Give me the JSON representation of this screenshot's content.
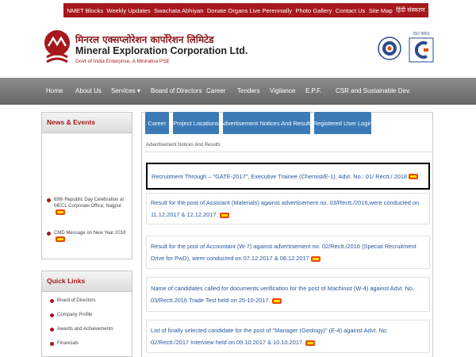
{
  "top_links": [
    "NMET Blocks",
    "Weekly Updates",
    "Swachata Abhiyan",
    "Donate Organs Live Perennially",
    "Photo Gallery",
    "Contact Us",
    "Site Map",
    "हिंदी संस्करण"
  ],
  "header": {
    "hindi_name": "मिनरल एक्सप्लोरेशन कार्पोरेशन लिमिटेड",
    "company_name": "Mineral Exploration Corporation Ltd.",
    "govt_line": "Govt of India Enterprise, A Miniratna PSE",
    "cert_label": "ISO 9001"
  },
  "nav": [
    "Home",
    "About Us",
    "Services ▾",
    "Board of Directors",
    "Career",
    "Tenders",
    "Vigilance",
    "E.P.F.",
    "CSR and Sustainable Dev."
  ],
  "news": {
    "title": "News & Events",
    "items": [
      "69th Republic Day Celebration at MECL Corporate Office, Nagpur",
      "CMD Message on New Year 2018"
    ]
  },
  "quick_links": {
    "title": "Quick Links",
    "items": [
      "Board of Directors",
      "Company Profile",
      "Awards and Achievements",
      "Financials"
    ]
  },
  "tabs": [
    "Career",
    "Project Locations",
    "Advertisement Notices And Results",
    "Registered User Login"
  ],
  "section_title": "Advertisement Notices And Results",
  "notices": [
    "Recruitment Through – \"GATE-2017\", Executive Trainee (Chemist/E-1), Advt. No.: 01/ Rectt./ 2018",
    "Result for the post of Assistant (Materials) against advertisement no. 03/Rectt./2016,were conducted on 11.12.2017 & 12.12.2017.",
    "Result for the post of Accountant (W-7) against advertisement no. 02/Rectt./2016 (Special Recruitment Drive for PwD), were conducted on 07.12.2017 & 08.12.2017",
    "Name of candidates called for documents verification for the post of Machinist (W-4) against Advt. No. 03/Rectt.2016 Trade Test held on 25-10-2017.",
    "List of finally selected candidate for the post of \"Manager (Geology)\" (E-4) against Advt. No. 02/Rectt./2017 Interview held on 09.10.2017 & 10.10.2017."
  ],
  "colors": {
    "brand_red": "#a6181b",
    "nav_gray": "#777777",
    "tab_blue": "#3c7ab7",
    "link_blue": "#24589c"
  }
}
